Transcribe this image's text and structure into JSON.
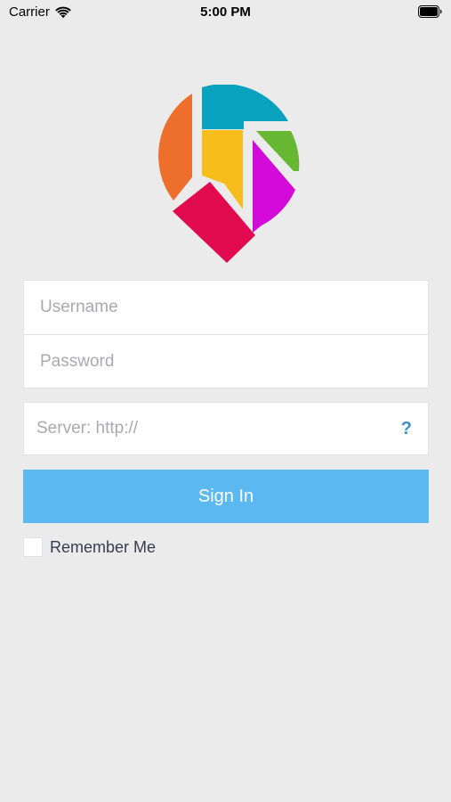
{
  "status_bar": {
    "carrier": "Carrier",
    "time": "5:00 PM",
    "wifi_icon": "wifi-icon",
    "battery_icon": "battery-icon"
  },
  "logo": {
    "icon": "map-pin-logo-icon",
    "colors": {
      "orange": "#ee6f2c",
      "teal": "#0aa3bf",
      "yellow": "#f6bd1b",
      "green": "#67b733",
      "magenta": "#d30ad9",
      "crimson": "#e1094f"
    }
  },
  "form": {
    "username_placeholder": "Username",
    "password_placeholder": "Password",
    "server_placeholder": "Server: http://",
    "help_label": "?",
    "signin_label": "Sign In",
    "remember_label": "Remember Me",
    "remember_checked": false
  },
  "colors": {
    "background": "#ebebeb",
    "button": "#5cb8f1",
    "help_accent": "#3a8fc9",
    "placeholder": "#a9a9b0",
    "label": "#3b3b52"
  }
}
